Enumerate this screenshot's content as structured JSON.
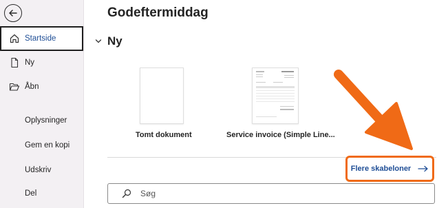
{
  "greeting": "Godeftermiddag",
  "sidebar": {
    "items": [
      {
        "label": "Startside",
        "icon": "home-icon",
        "active": true
      },
      {
        "label": "Ny",
        "icon": "new-document-icon"
      },
      {
        "label": "Åbn",
        "icon": "folder-open-icon"
      },
      {
        "label": "Oplysninger"
      },
      {
        "label": "Gem en kopi"
      },
      {
        "label": "Udskriv"
      },
      {
        "label": "Del"
      }
    ]
  },
  "new_section": {
    "title": "Ny",
    "templates": [
      {
        "label": "Tomt dokument"
      },
      {
        "label": "Service invoice (Simple Line..."
      }
    ]
  },
  "more_templates": {
    "label": "Flere skabeloner"
  },
  "search": {
    "placeholder": "Søg"
  },
  "colors": {
    "accent": "#1f4e96",
    "highlight": "#f06a16",
    "sidebar_bg": "#f3f0f3"
  }
}
